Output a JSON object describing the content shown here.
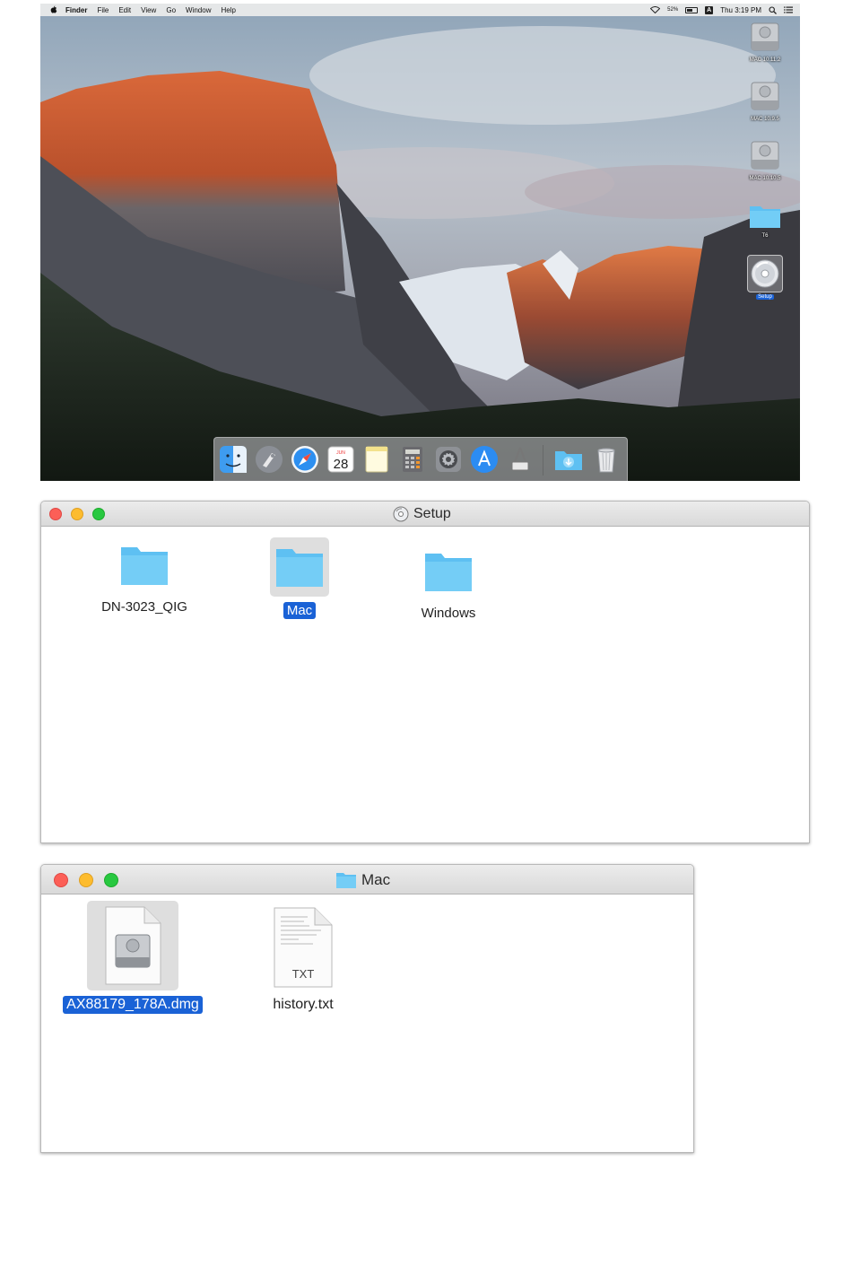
{
  "menubar": {
    "items": [
      "Finder",
      "File",
      "Edit",
      "View",
      "Go",
      "Window",
      "Help"
    ],
    "battery": "52%",
    "input_source": "A",
    "clock": "Thu 3:19 PM"
  },
  "desktop_icons": [
    {
      "label": "MAC 10.11.2",
      "icon": "hard-drive-icon"
    },
    {
      "label": "MAC 10.9.5",
      "icon": "hard-drive-icon"
    },
    {
      "label": "MAC 10.10.5",
      "icon": "hard-drive-icon"
    },
    {
      "label": "T6",
      "icon": "folder-icon"
    },
    {
      "label": "Setup",
      "icon": "disc-icon"
    }
  ],
  "dock": {
    "items": [
      "finder-icon",
      "launchpad-icon",
      "safari-icon",
      "calendar-icon",
      "notes-icon",
      "calculator-icon",
      "system-preferences-icon",
      "app-store-icon",
      "ftdi-utility-icon",
      "downloads-folder-icon",
      "trash-icon"
    ],
    "calendar": {
      "month": "JUN",
      "day": "28"
    }
  },
  "setup_window": {
    "title": "Setup",
    "items": [
      {
        "name": "DN-3023_QIG",
        "selected": false
      },
      {
        "name": "Mac",
        "selected": true
      },
      {
        "name": "Windows",
        "selected": false
      }
    ]
  },
  "mac_window": {
    "title": "Mac",
    "items": [
      {
        "name": "AX88179_178A.dmg",
        "selected": true
      },
      {
        "name": "history.txt",
        "badge": "TXT",
        "selected": false
      }
    ]
  },
  "colors": {
    "selection_blue": "#1a62d6",
    "folder_blue": "#5ec0f2",
    "traffic_red": "#fc5f57",
    "traffic_yellow": "#fdbc2e",
    "traffic_green": "#28c840"
  }
}
